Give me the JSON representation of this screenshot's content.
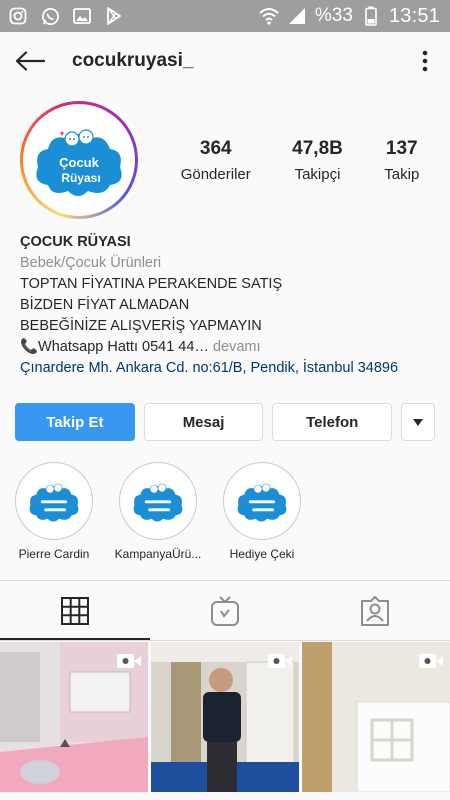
{
  "status_bar": {
    "icons": [
      "instagram-icon",
      "whatsapp-icon",
      "image-icon",
      "play-store-icon"
    ],
    "battery": "%33",
    "time": "13:51"
  },
  "header": {
    "username": "cocukruyasi_"
  },
  "profile": {
    "logo_text_top": "Çocuk",
    "logo_text_bottom": "Rüyası",
    "stats": [
      {
        "value": "364",
        "label": "Gönderiler"
      },
      {
        "value": "47,8B",
        "label": "Takipçi"
      },
      {
        "value": "137",
        "label": "Takip"
      }
    ]
  },
  "bio": {
    "name": "ÇOCUK RÜYASI",
    "category": "Bebek/Çocuk Ürünleri",
    "lines": [
      "TOPTAN FİYATINA PERAKENDE SATIŞ",
      "BİZDEN FİYAT ALMADAN",
      "BEBEĞİNİZE ALIŞVERİŞ YAPMAYIN"
    ],
    "whatsapp": "📞Whatsapp Hattı 0541 44…",
    "more": " devamı",
    "address": "Çınardere Mh. Ankara Cd. no:61/B, Pendik, İstanbul 34896"
  },
  "actions": {
    "follow": "Takip Et",
    "message": "Mesaj",
    "phone": "Telefon"
  },
  "highlights": [
    {
      "label": "Pierre Cardin"
    },
    {
      "label": "KampanyaÜrü..."
    },
    {
      "label": "Hediye Çeki"
    }
  ],
  "tabs": [
    "grid-icon",
    "igtv-icon",
    "tagged-icon"
  ],
  "colors": {
    "accent": "#3897f0",
    "text": "#262626",
    "secondary": "#8e8e8e",
    "link": "#00376b",
    "logo_blue": "#1a8fd6"
  }
}
